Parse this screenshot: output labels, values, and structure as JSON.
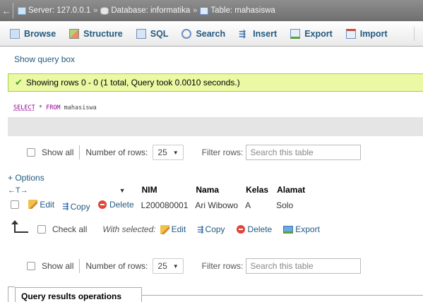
{
  "breadcrumb": {
    "back": "←",
    "server": "Server: 127.0.0.1",
    "database": "Database: informatika",
    "table": "Table: mahasiswa",
    "separator": "»"
  },
  "tabs": [
    {
      "label": "Browse",
      "icon": "browse-icon"
    },
    {
      "label": "Structure",
      "icon": "structure-icon"
    },
    {
      "label": "SQL",
      "icon": "sql-icon"
    },
    {
      "label": "Search",
      "icon": "search-icon"
    },
    {
      "label": "Insert",
      "icon": "insert-icon"
    },
    {
      "label": "Export",
      "icon": "export-icon"
    },
    {
      "label": "Import",
      "icon": "import-icon"
    }
  ],
  "show_query_box": "Show query box",
  "message": "Showing rows 0 - 0 (1 total, Query took 0.0010 seconds.)",
  "sql": {
    "select": "SELECT",
    "rest": " * ",
    "from": "FROM",
    "table": " mahasiswa"
  },
  "navigation": {
    "show_all": "Show all",
    "rows_label": "Number of rows:",
    "rows_value": "25",
    "filter_label": "Filter rows:",
    "filter_placeholder": "Search this table"
  },
  "options_link": "+ Options",
  "table": {
    "sort_arrows": "←T→",
    "columns": [
      "NIM",
      "Nama",
      "Kelas",
      "Alamat"
    ],
    "row_actions": {
      "edit": "Edit",
      "copy": "Copy",
      "delete": "Delete"
    },
    "rows": [
      {
        "nim": "L200080001",
        "nama": "Ari Wibowo",
        "kelas": "A",
        "alamat": "Solo"
      }
    ]
  },
  "bulk": {
    "check_all": "Check all",
    "with_selected": "With selected:",
    "edit": "Edit",
    "copy": "Copy",
    "delete": "Delete",
    "export": "Export"
  },
  "query_results_operations": "Query results operations",
  "colors": {
    "link": "#235a81",
    "success_bg": "#ebf8a4",
    "success_border": "#a2d246",
    "topbar": "#7f7f7f"
  }
}
